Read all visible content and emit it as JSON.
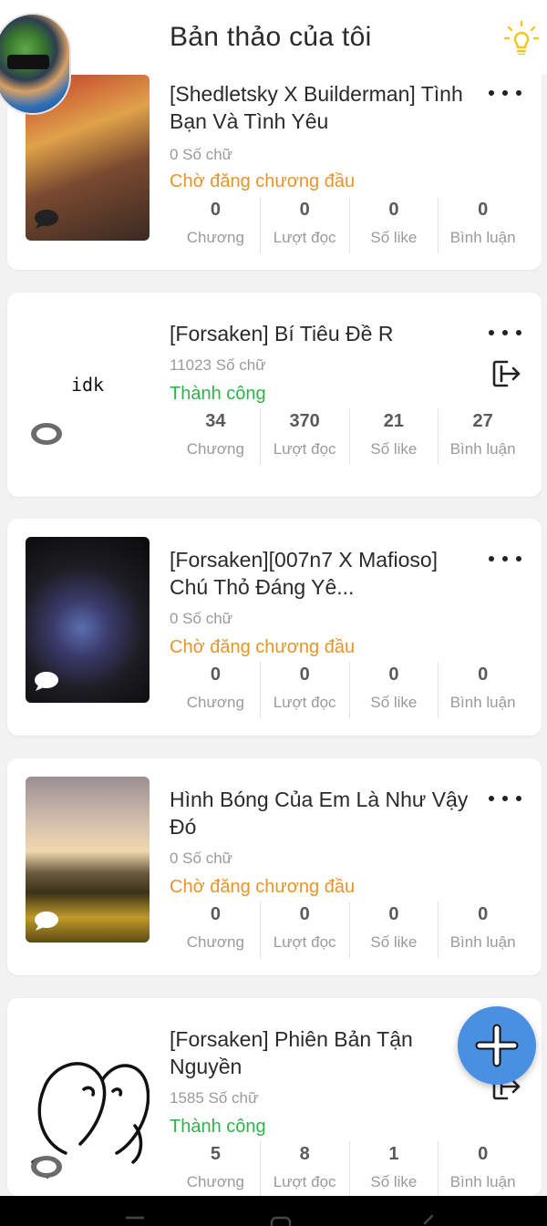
{
  "header": {
    "title": "Bản thảo của tôi"
  },
  "stat_labels": {
    "chapters": "Chương",
    "reads": "Lượt đọc",
    "likes": "Số like",
    "comments": "Bình luận"
  },
  "stories": [
    {
      "title": "[Shedletsky X Builderman] Tình Bạn Và Tình Yêu",
      "word_count": "0 Số chữ",
      "status": "Chờ đăng chương đầu",
      "stats": {
        "chapters": "0",
        "reads": "0",
        "likes": "0",
        "comments": "0"
      }
    },
    {
      "title": "[Forsaken] Bí Tiêu Đề R",
      "cover_text": "idk",
      "word_count": "11023 Số chữ",
      "status": "Thành công",
      "stats": {
        "chapters": "34",
        "reads": "370",
        "likes": "21",
        "comments": "27"
      }
    },
    {
      "title": "[Forsaken][007n7 X Mafioso] Chú Thỏ Đáng Yê...",
      "word_count": "0 Số chữ",
      "status": "Chờ đăng chương đầu",
      "stats": {
        "chapters": "0",
        "reads": "0",
        "likes": "0",
        "comments": "0"
      }
    },
    {
      "title": "Hình Bóng Của Em Là Như Vậy Đó",
      "word_count": "0 Số chữ",
      "status": "Chờ đăng chương đầu",
      "stats": {
        "chapters": "0",
        "reads": "0",
        "likes": "0",
        "comments": "0"
      }
    },
    {
      "title": "[Forsaken] Phiên Bản Tận Nguyền",
      "word_count": "1585 Số chữ",
      "status": "Thành công",
      "stats": {
        "chapters": "5",
        "reads": "8",
        "likes": "1",
        "comments": "0"
      }
    }
  ],
  "colors": {
    "pending": "#e8942a",
    "success": "#2fb24c",
    "fab": "#4a90e2",
    "bulb": "#f5c518"
  },
  "icons": {
    "menu": "more-dots-icon",
    "export": "export-icon",
    "comment": "comment-bubble-icon",
    "add": "plus-icon",
    "tip": "lightbulb-icon"
  }
}
